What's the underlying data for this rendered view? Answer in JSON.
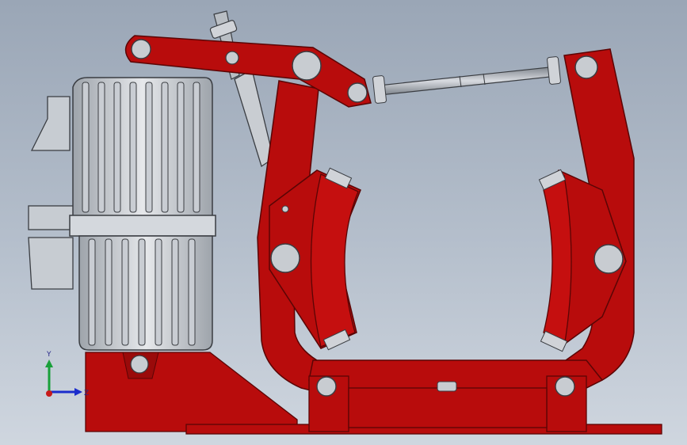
{
  "viewport": {
    "background_top": "#9aa6b6",
    "background_bottom": "#cfd6df"
  },
  "model": {
    "frame_color": "#b80c0c",
    "frame_shadow": "#7d0606",
    "motor_color": "#c9cdd3",
    "motor_dark": "#8e949c"
  },
  "triad": {
    "y_label": "Y",
    "z_label": "Z",
    "y_color": "#19a03a",
    "z_color": "#1a2ccc",
    "x_color": "#c81a1a"
  }
}
